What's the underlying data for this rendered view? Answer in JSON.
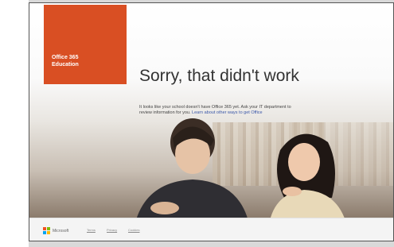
{
  "logo_tile": {
    "line1": "Office 365",
    "line2": "Education",
    "color": "#d94f23"
  },
  "error": {
    "title": "Sorry, that didn't work",
    "message": "It looks like your school doesn't have Office 365 yet. Ask your IT department to",
    "message_line2": "review information for you.",
    "link": "Learn about other ways to get Office"
  },
  "footer": {
    "brand": "Microsoft",
    "links": [
      "Terms",
      "Privacy",
      "Cookies"
    ],
    "brand_colors": [
      "#f25022",
      "#7fba00",
      "#00a4ef",
      "#ffb900"
    ]
  }
}
